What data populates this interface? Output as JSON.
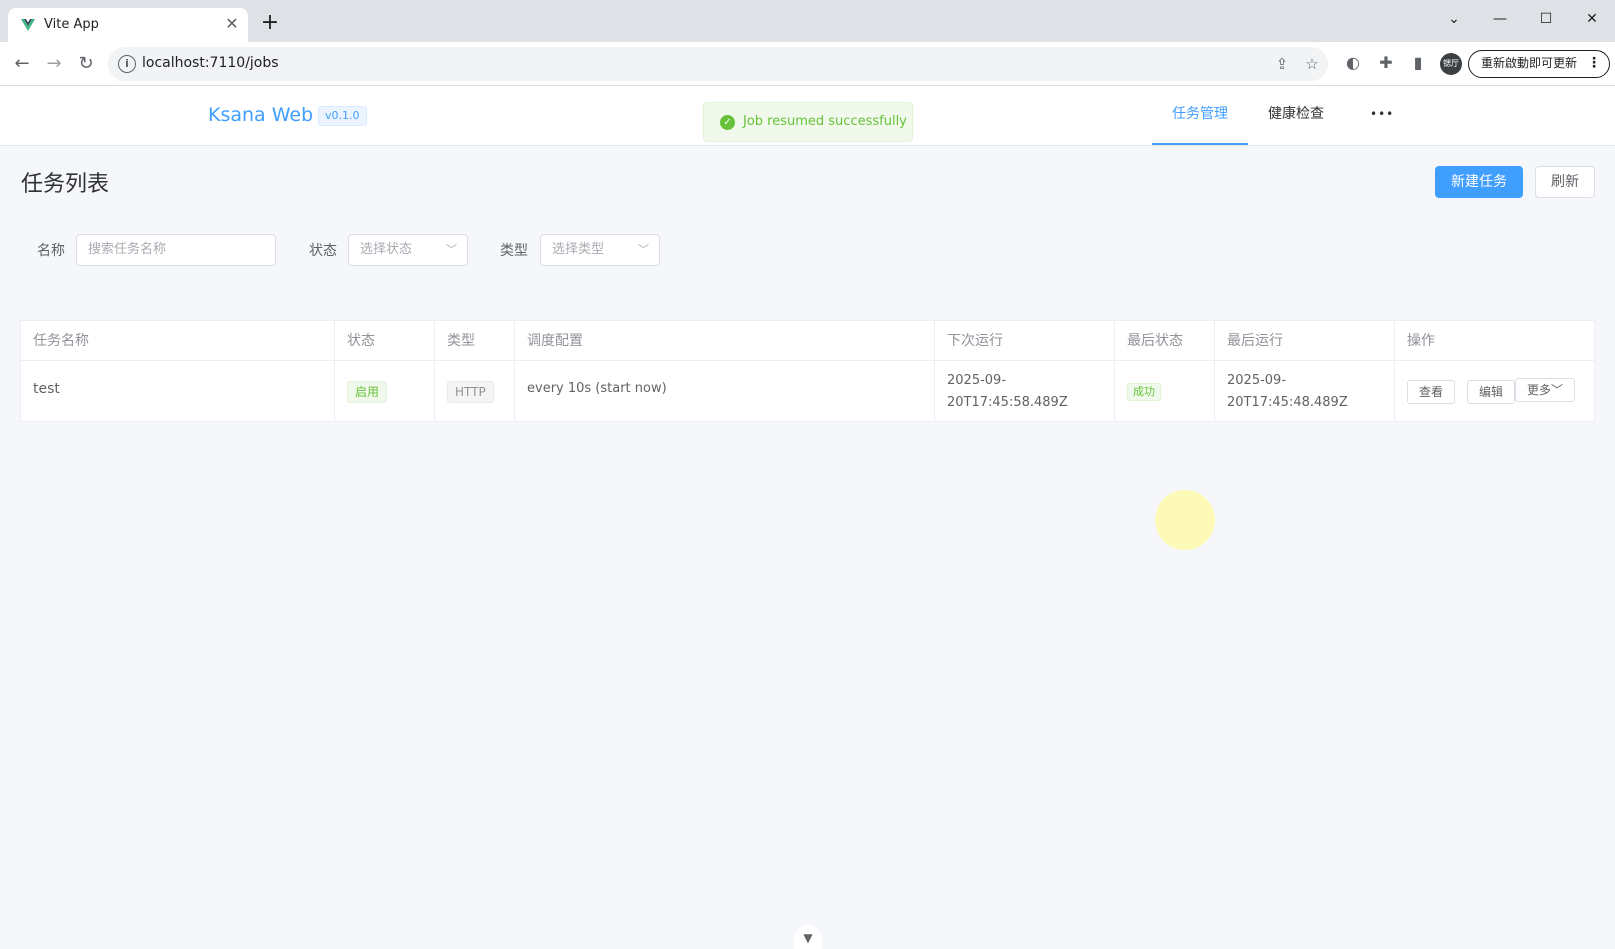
{
  "browser": {
    "tab_title": "Vite App",
    "url": "localhost:7110/jobs",
    "profile_initials": "锶厅",
    "update_label": "重新啟動即可更新"
  },
  "header": {
    "brand": "Ksana Web",
    "version": "v0.1.0",
    "menu": [
      {
        "label": "任务管理",
        "active": true
      },
      {
        "label": "健康检查",
        "active": false
      }
    ],
    "more": "•••"
  },
  "toast": {
    "message": "Job resumed successfully",
    "type": "success"
  },
  "page": {
    "title": "任务列表",
    "new_button": "新建任务",
    "refresh_button": "刷新"
  },
  "filters": {
    "name_label": "名称",
    "name_placeholder": "搜索任务名称",
    "status_label": "状态",
    "status_placeholder": "选择状态",
    "type_label": "类型",
    "type_placeholder": "选择类型"
  },
  "table": {
    "columns": [
      "任务名称",
      "状态",
      "类型",
      "调度配置",
      "下次运行",
      "最后状态",
      "最后运行",
      "操作"
    ],
    "rows": [
      {
        "name": "test",
        "status": "启用",
        "type": "HTTP",
        "schedule": "every 10s (start now)",
        "next_run_line1": "2025-09-",
        "next_run_line2": "20T17:45:58.489Z",
        "last_status": "成功",
        "last_run_line1": "2025-09-",
        "last_run_line2": "20T17:45:48.489Z",
        "actions": {
          "view": "查看",
          "edit": "编辑",
          "more": "更多"
        }
      }
    ]
  },
  "colors": {
    "primary": "#409eff",
    "success": "#67c23a",
    "info": "#909399"
  }
}
